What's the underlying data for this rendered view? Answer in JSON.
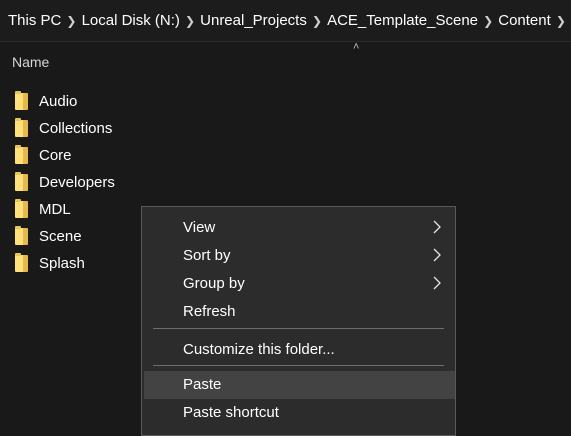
{
  "breadcrumb": {
    "items": [
      "This PC",
      "Local Disk (N:)",
      "Unreal_Projects",
      "ACE_Template_Scene",
      "Content"
    ],
    "separator_icon": "chevron-right-icon"
  },
  "list": {
    "column_header": "Name",
    "sort_icon": "chevron-up-icon",
    "folders": [
      "Audio",
      "Collections",
      "Core",
      "Developers",
      "MDL",
      "Scene",
      "Splash"
    ]
  },
  "context_menu": {
    "view": "View",
    "sort_by": "Sort by",
    "group_by": "Group by",
    "refresh": "Refresh",
    "customize": "Customize this folder...",
    "paste": "Paste",
    "paste_shortcut": "Paste shortcut",
    "highlighted_item": "Paste"
  },
  "colors": {
    "background": "#191919",
    "menu_background": "#2c2c2c",
    "menu_hover": "#434343",
    "folder_yellow": "#ffe07a"
  }
}
